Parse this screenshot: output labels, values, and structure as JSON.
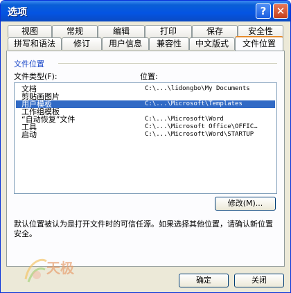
{
  "window": {
    "title": "选项",
    "help_symbol": "?",
    "close_symbol": "✕"
  },
  "tabs_row1": [
    "视图",
    "常规",
    "编辑",
    "打印",
    "保存",
    "安全性"
  ],
  "tabs_row2": [
    "拼写和语法",
    "修订",
    "用户信息",
    "兼容性",
    "中文版式",
    "文件位置"
  ],
  "panel": {
    "group_title": "文件位置",
    "col_type": "文件类型(F):",
    "col_location": "位置:",
    "rows": [
      {
        "type": "文档",
        "location": "C:\\...\\lidongbo\\My Documents"
      },
      {
        "type": "剪贴画图片",
        "location": ""
      },
      {
        "type": "用户模板",
        "location": "C:\\...\\Microsoft\\Templates"
      },
      {
        "type": "工作组模板",
        "location": ""
      },
      {
        "type": "“自动恢复”文件",
        "location": "C:\\...\\Microsoft\\Word"
      },
      {
        "type": "工具",
        "location": "C:\\...\\Microsoft Office\\OFFIC…"
      },
      {
        "type": "启动",
        "location": "C:\\...\\Microsoft\\Word\\STARTUP"
      }
    ],
    "selected_index": 2,
    "modify_button": "修改(M)...",
    "description": "默认位置被认为是打开文件时的可信任源。如果选择其他位置，请确认新位置安全。"
  },
  "footer": {
    "ok": "确定",
    "cancel": "关闭"
  },
  "watermark": {
    "text": "天极"
  }
}
